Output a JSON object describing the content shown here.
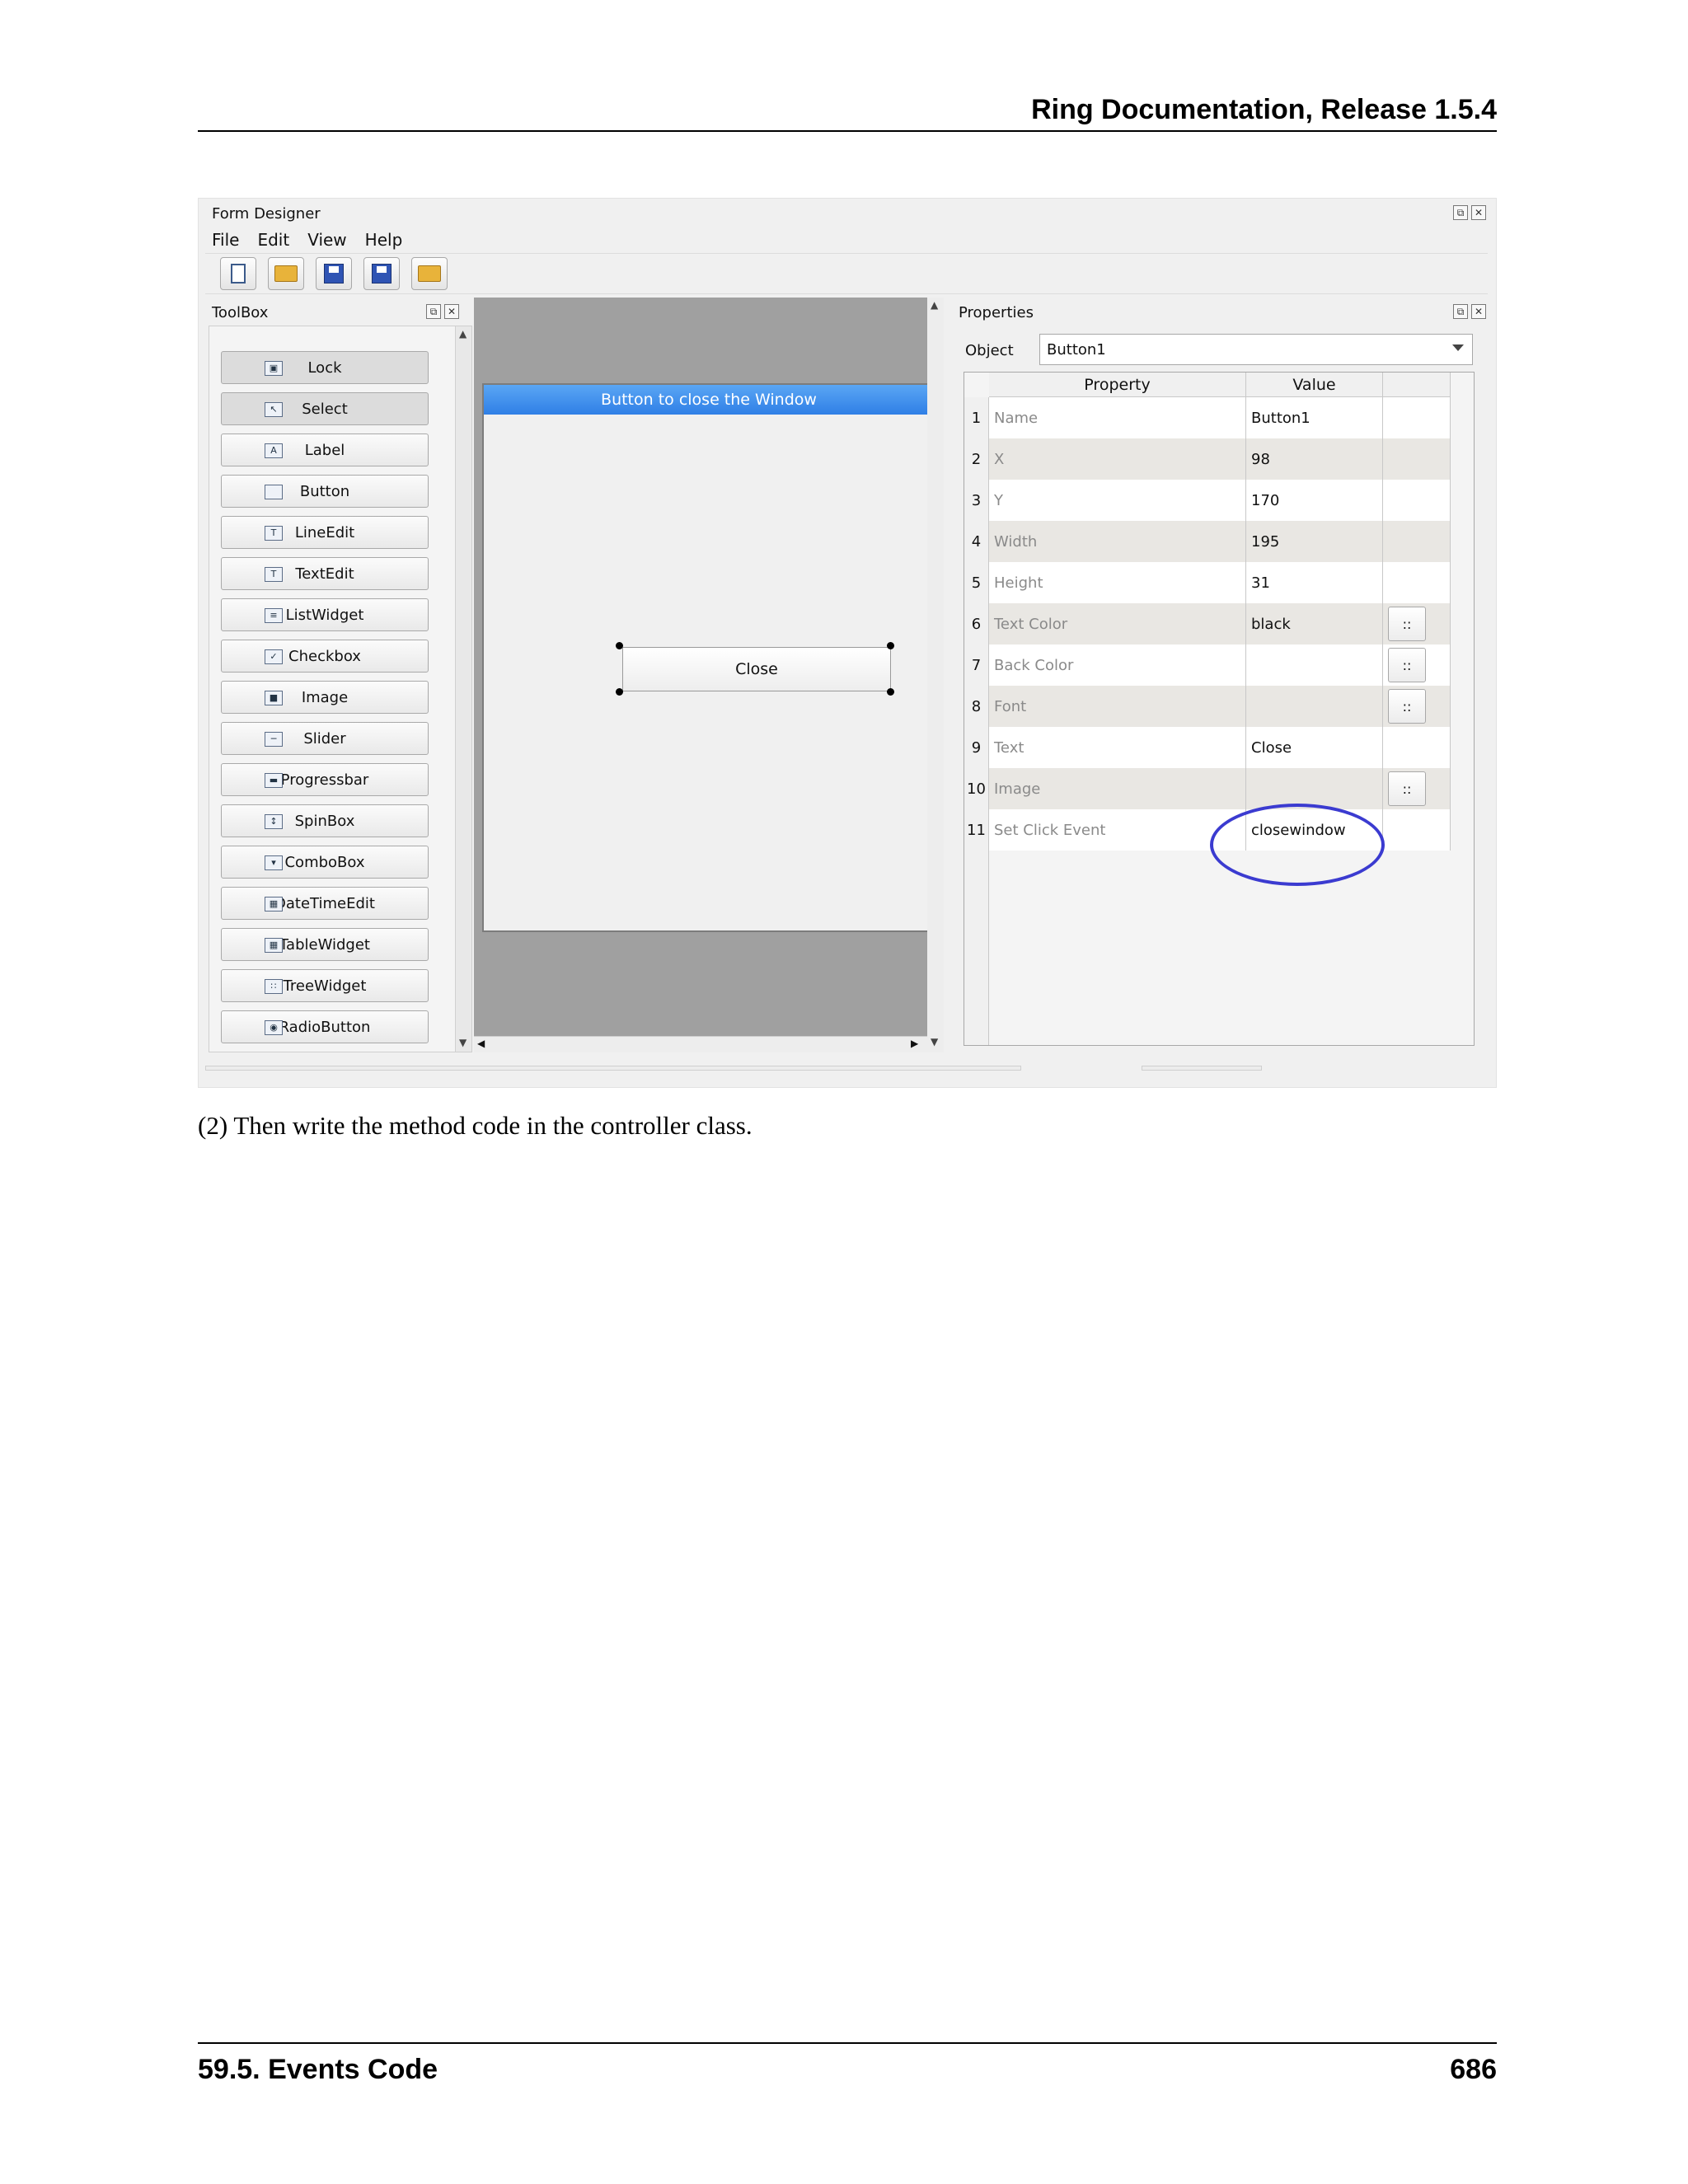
{
  "header": {
    "title": "Ring Documentation, Release 1.5.4"
  },
  "footer": {
    "section": "59.5.  Events Code",
    "page": "686"
  },
  "caption": "(2) Then write the method code in the controller class.",
  "screenshot": {
    "window_title": "Form Designer",
    "menu": [
      "File",
      "Edit",
      "View",
      "Help"
    ],
    "toolbox": {
      "title": "ToolBox",
      "items": [
        "Lock",
        "Select",
        "Label",
        "Button",
        "LineEdit",
        "TextEdit",
        "ListWidget",
        "Checkbox",
        "Image",
        "Slider",
        "Progressbar",
        "SpinBox",
        "ComboBox",
        "DateTimeEdit",
        "TableWidget",
        "TreeWidget",
        "RadioButton"
      ]
    },
    "form": {
      "title": "Button to close the Window",
      "button_text": "Close"
    },
    "properties": {
      "title": "Properties",
      "object_label": "Object",
      "object_value": "Button1",
      "col_property": "Property",
      "col_value": "Value",
      "rows": [
        {
          "n": "1",
          "prop": "Name",
          "val": "Button1",
          "btn": ""
        },
        {
          "n": "2",
          "prop": "X",
          "val": "98",
          "btn": ""
        },
        {
          "n": "3",
          "prop": "Y",
          "val": "170",
          "btn": ""
        },
        {
          "n": "4",
          "prop": "Width",
          "val": "195",
          "btn": ""
        },
        {
          "n": "5",
          "prop": "Height",
          "val": "31",
          "btn": ""
        },
        {
          "n": "6",
          "prop": "Text Color",
          "val": "black",
          "btn": "::"
        },
        {
          "n": "7",
          "prop": "Back Color",
          "val": "",
          "btn": "::"
        },
        {
          "n": "8",
          "prop": "Font",
          "val": "",
          "btn": "::"
        },
        {
          "n": "9",
          "prop": "Text",
          "val": "Close",
          "btn": ""
        },
        {
          "n": "10",
          "prop": "Image",
          "val": "",
          "btn": "::"
        },
        {
          "n": "11",
          "prop": "Set Click Event",
          "val": "closewindow",
          "btn": ""
        }
      ]
    },
    "colors": {
      "form_title_bar": "#2f7fe6",
      "highlight_ellipse": "#3b3bd0"
    }
  }
}
